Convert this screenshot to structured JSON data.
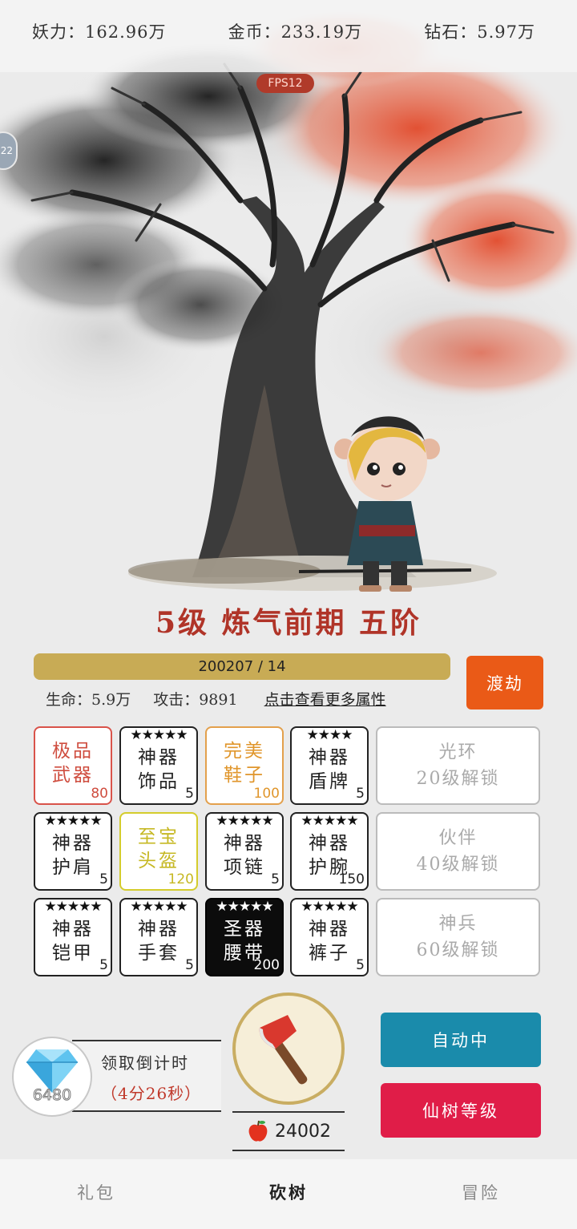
{
  "resources": {
    "yaoli": "妖力：162.96万",
    "gold": "金币：233.19万",
    "diamond": "钻石：5.97万"
  },
  "fps": "FPS12",
  "side_bubble": "22",
  "realm_title": "5级 炼气前期 五阶",
  "exp": {
    "text": "200207 / 14",
    "progress": 1.0
  },
  "dujie_label": "渡劫",
  "stats": {
    "hp": "生命：5.9万",
    "atk": "攻击：9891",
    "more_link": "点击查看更多属性"
  },
  "equipment": [
    {
      "name": "极品\n武器",
      "stars": "",
      "level": "80",
      "quality": "red"
    },
    {
      "name": "神器\n饰品",
      "stars": "★★★★★",
      "level": "5",
      "quality": "normal"
    },
    {
      "name": "完美\n鞋子",
      "stars": "",
      "level": "100",
      "quality": "orange"
    },
    {
      "name": "神器\n盾牌",
      "stars": "★★★★",
      "level": "5",
      "quality": "normal"
    },
    {
      "name": "神器\n护肩",
      "stars": "★★★★★",
      "level": "5",
      "quality": "normal"
    },
    {
      "name": "至宝\n头盔",
      "stars": "",
      "level": "120",
      "quality": "yellow"
    },
    {
      "name": "神器\n项链",
      "stars": "★★★★★",
      "level": "5",
      "quality": "normal"
    },
    {
      "name": "神器\n护腕",
      "stars": "★★★★★",
      "level": "150",
      "quality": "normal"
    },
    {
      "name": "神器\n铠甲",
      "stars": "★★★★★",
      "level": "5",
      "quality": "normal"
    },
    {
      "name": "神器\n手套",
      "stars": "★★★★★",
      "level": "5",
      "quality": "normal"
    },
    {
      "name": "圣器\n腰带",
      "stars": "★★★★★",
      "level": "200",
      "quality": "black"
    },
    {
      "name": "神器\n裤子",
      "stars": "★★★★★",
      "level": "5",
      "quality": "normal"
    }
  ],
  "locked_slots": [
    {
      "name": "光环",
      "unlock": "20级解锁"
    },
    {
      "name": "伙伴",
      "unlock": "40级解锁"
    },
    {
      "name": "神兵",
      "unlock": "60级解锁"
    }
  ],
  "diamond_count": "6480",
  "timer": {
    "label": "领取倒计时",
    "value": "（4分26秒）"
  },
  "apple_count": "24002",
  "auto_label": "自动中",
  "tree_level_label": "仙树等级",
  "nav": {
    "gift": "礼包",
    "chop": "砍树",
    "adventure": "冒险"
  },
  "colors": {
    "accent_red": "#b03428",
    "dujie": "#ea5a17",
    "auto": "#1a8bab",
    "tree_level": "#e01d48",
    "exp_fill": "#c8ab55"
  }
}
